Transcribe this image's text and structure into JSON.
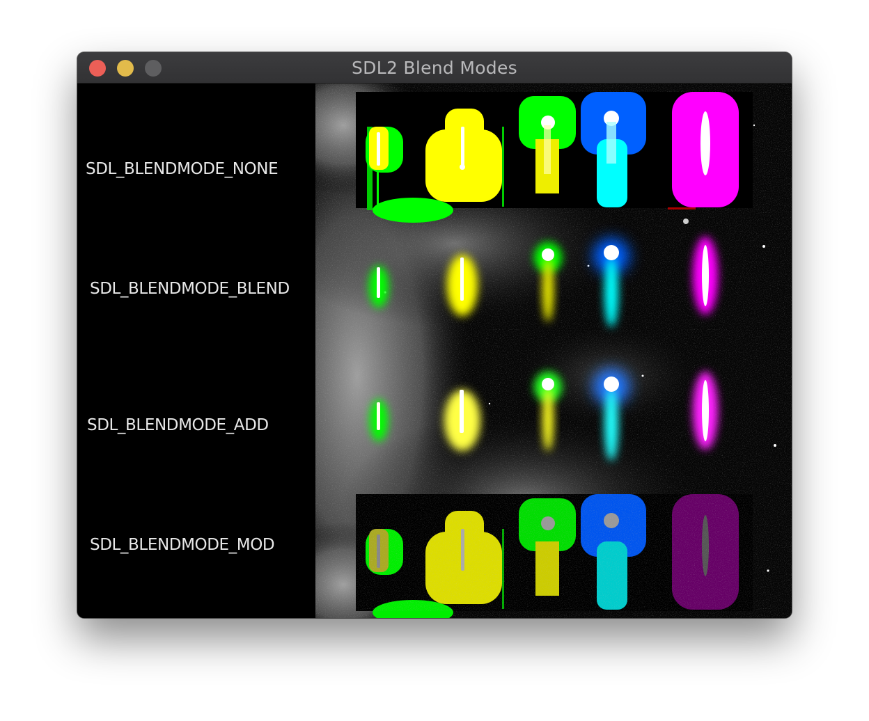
{
  "window": {
    "title": "SDL2 Blend Modes",
    "controls": [
      "close",
      "minimize",
      "zoom"
    ]
  },
  "rows": [
    {
      "label": "SDL_BLENDMODE_NONE"
    },
    {
      "label": "SDL_BLENDMODE_BLEND"
    },
    {
      "label": "SDL_BLENDMODE_ADD"
    },
    {
      "label": "SDL_BLENDMODE_MOD"
    }
  ],
  "sprites": [
    {
      "name": "green-flame",
      "color": "#00ff00"
    },
    {
      "name": "yellow-flame",
      "color": "#ffff00"
    },
    {
      "name": "green-yellow-flame",
      "color": "#11ee11"
    },
    {
      "name": "blue-cyan-flame",
      "color": "#00ffff"
    },
    {
      "name": "magenta-flame",
      "color": "#ff00ff"
    }
  ],
  "colors": {
    "close": "#ec5f57",
    "minimize": "#e2bb4b",
    "zoom": "#5e5e60",
    "background": "#000000",
    "label_text": "#e8e8e8"
  }
}
